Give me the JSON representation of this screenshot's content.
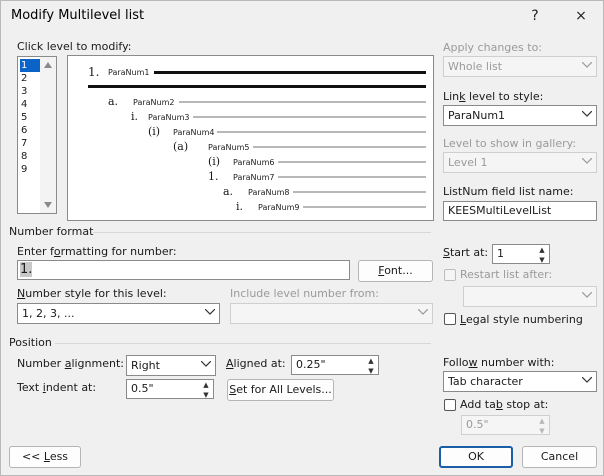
{
  "window": {
    "title": "Modify Multilevel list",
    "help": "?",
    "close": "×"
  },
  "levels": {
    "label": "Click level to modify:",
    "items": [
      "1",
      "2",
      "3",
      "4",
      "5",
      "6",
      "7",
      "8",
      "9"
    ],
    "selected": "1"
  },
  "preview": {
    "rows": [
      {
        "num": "1.",
        "text": "ParaNum1"
      },
      {
        "num": "a.",
        "text": "ParaNum2"
      },
      {
        "num": "i.",
        "text": "ParaNum3"
      },
      {
        "num": "(i)",
        "text": "ParaNum4"
      },
      {
        "num": "(a)",
        "text": "ParaNum5"
      },
      {
        "num": "(i)",
        "text": "ParaNum6"
      },
      {
        "num": "1.",
        "text": "ParaNum7"
      },
      {
        "num": "a.",
        "text": "ParaNum8"
      },
      {
        "num": "i.",
        "text": "ParaNum9"
      }
    ]
  },
  "right": {
    "apply_label": "Apply changes to:",
    "apply_value": "Whole list",
    "link_label": "Link level to style:",
    "link_value": "ParaNum1",
    "gallery_label": "Level to show in gallery:",
    "gallery_value": "Level 1",
    "listnum_label": "ListNum field list name:",
    "listnum_value": "KEESMultiLevelList"
  },
  "number_format": {
    "section": "Number format",
    "enter_label": "Enter formatting for number:",
    "format_value": "1.",
    "font_button": "Font...",
    "style_label": "Number style for this level:",
    "style_value": "1, 2, 3, ...",
    "include_label": "Include level number from:",
    "include_value": "",
    "start_label": "Start at:",
    "start_value": "1",
    "restart_label": "Restart list after:",
    "restart_value": "",
    "legal_label": "Legal style numbering"
  },
  "position": {
    "section": "Position",
    "alignment_label": "Number alignment:",
    "alignment_value": "Right",
    "aligned_at_label": "Aligned at:",
    "aligned_at_value": "0.25\"",
    "indent_label": "Text indent at:",
    "indent_value": "0.5\"",
    "set_all_button": "Set for All Levels...",
    "follow_label": "Follow number with:",
    "follow_value": "Tab character",
    "tab_stop_label": "Add tab stop at:",
    "tab_stop_value": "0.5\""
  },
  "footer": {
    "less_button": "<< Less",
    "ok_button": "OK",
    "cancel_button": "Cancel"
  }
}
